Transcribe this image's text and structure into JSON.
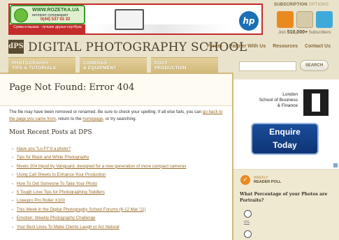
{
  "banner": {
    "url": "WWW.ROZETKA.UA",
    "subtitle": "интернет супермаркет",
    "phone": "0(44) 537 02 22",
    "slogan": "Сумка и мышка - лучшие друзья ноутбука",
    "brand": "hp"
  },
  "subscription": {
    "title": "SUBSCRIPTION",
    "options": "OPTIONS",
    "count_prefix": "Join",
    "count": "510,000+",
    "count_suffix": "Subscribers"
  },
  "site": {
    "logo_mark": "dPS",
    "name": "DIGITAL PHOTOGRAPHY SCHOOL",
    "top_nav": [
      "Forum",
      "Partner With Us",
      "Resources",
      "Contact Us"
    ],
    "tabs": [
      {
        "line1": "PHOTOGRAPHY",
        "line2": "TIPS & TUTORIALS"
      },
      {
        "line1": "CAMERAS",
        "line2": "& EQUIPMENT"
      },
      {
        "line1": "POST",
        "line2": "PRODUCTION"
      }
    ],
    "search_button": "SEARCH"
  },
  "page": {
    "title": "Page Not Found: Error 404",
    "msg_part1": "The file may have been removed or renamed. Be sure to check your spelling. If all else fails, you can ",
    "msg_link1": "go back to the page you came from",
    "msg_part2": ", return to the ",
    "msg_link2": "homepage",
    "msg_part3": ", or try searching.",
    "recent_heading": "Most Recent Posts at DPS",
    "recent_posts": [
      "Have you \"Lo-FI\"'d a photo?",
      "Tips for Black and White Photography",
      "Nivelo 204 tripod by Vanguard, designed for a new generation of more compact cameras",
      "Using Call Sheets to Enhance Your Production",
      "How To Get Someone To Take Your Photo",
      "5 Tough Love Tips for Photographing Toddlers",
      "Lowepro Pro Roller X100",
      "This Week in the Digital Photography School Forums (6-12 Mar '11)",
      "Emotion: Weekly Photography Challenge",
      "Your Best Lines To Make Clients Laugh or Act Natural"
    ]
  },
  "ad": {
    "school_line1": "London",
    "school_line2": "School of Business",
    "school_line3": "& Finance",
    "cta_line1": "Enquire",
    "cta_line2": "Today"
  },
  "poll": {
    "label1": "WEEKLY",
    "label2": "READER POLL",
    "question": "What Percentage of your Photos are Portraits?",
    "first_option_pct": "0%"
  },
  "colors": {
    "background": "#e9e3cc",
    "link": "#9b6a2a",
    "tab": "#d1b97a",
    "cta": "#0e3475"
  }
}
